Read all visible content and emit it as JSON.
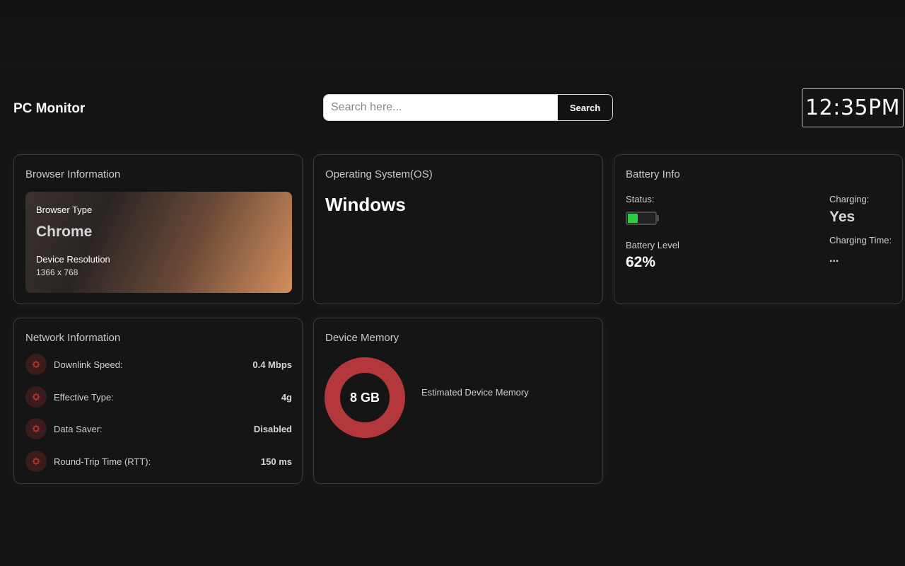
{
  "header": {
    "title": "PC Monitor",
    "search": {
      "placeholder": "Search here...",
      "value": "",
      "button_label": "Search"
    },
    "clock": "12:35PM"
  },
  "browser_card": {
    "title": "Browser Information",
    "type_label": "Browser Type",
    "type_value": "Chrome",
    "resolution_label": "Device Resolution",
    "resolution_value": "1366 x 768"
  },
  "os_card": {
    "title": "Operating System(OS)",
    "value": "Windows"
  },
  "battery_card": {
    "title": "Battery Info",
    "status_label": "Status:",
    "level_fraction": 0.35,
    "level_label": "Battery Level",
    "level_value": "62%",
    "charging_label": "Charging:",
    "charging_value": "Yes",
    "charging_time_label": "Charging Time:",
    "charging_time_value": "...",
    "fill_color": "#2ecc40"
  },
  "network_card": {
    "title": "Network Information",
    "icon": "network-icon",
    "accent_color": "#c0392b",
    "rows": [
      {
        "label": "Downlink Speed:",
        "value": "0.4 Mbps"
      },
      {
        "label": "Effective Type:",
        "value": "4g"
      },
      {
        "label": "Data Saver:",
        "value": "Disabled"
      },
      {
        "label": "Round-Trip Time (RTT):",
        "value": "150 ms"
      }
    ]
  },
  "memory_card": {
    "title": "Device Memory",
    "value": "8 GB",
    "caption": "Estimated Device Memory",
    "ring_color": "#b3373b"
  }
}
